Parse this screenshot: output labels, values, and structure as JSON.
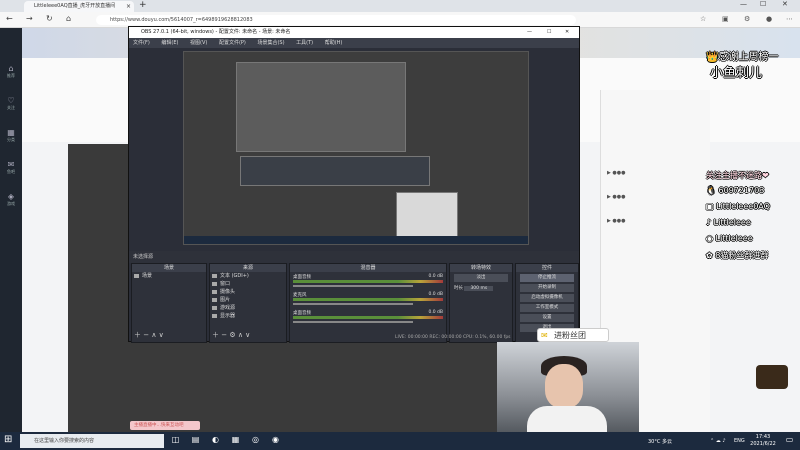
{
  "browser": {
    "tab_title": "Littleleee0AQ直播_虎牙开放直播间",
    "url": "https://www.douyu.com/5614007_r=6498919628812083"
  },
  "left_nav": [
    "推荐",
    "关注",
    "分类",
    "鱼吧",
    "游戏"
  ],
  "obs": {
    "window_title": "OBS 27.0.1 (64-bit, windows) - 配置文件: 未命名 - 场景: 未命名",
    "menu": [
      "文件(F)",
      "编辑(E)",
      "视图(V)",
      "配置文件(P)",
      "场景集合(S)",
      "工具(T)",
      "帮助(H)"
    ],
    "scene_label": "未选择源",
    "docks": {
      "scenes": "场景",
      "sources": "来源",
      "mixer": "混音器",
      "transitions": "转场特效",
      "controls": "控件"
    },
    "scenes_list": [
      "场景"
    ],
    "sources_list": [
      "文本 (GDI+)",
      "窗口",
      "摄像头",
      "图片",
      "游戏源",
      "显示器"
    ],
    "mixer": [
      {
        "name": "桌面音频",
        "value": "0.0 dB"
      },
      {
        "name": "麦克风",
        "value": "0.0 dB"
      },
      {
        "name": "桌面音频",
        "value": "0.0 dB"
      }
    ],
    "transition_type": "淡出",
    "transition_duration_label": "时长",
    "transition_duration": "300 ms",
    "control_buttons": [
      "停止推流",
      "开始录制",
      "启动虚拟摄像机",
      "工作室模式",
      "设置",
      "退出"
    ],
    "status": "LIVE: 00:00:00  REC: 00:00:00  CPU: 0.1%, 60.00 fps"
  },
  "overlay": {
    "thanks": "👑感谢上周榜一",
    "fan_name": "小鱼刺儿",
    "follow": "关注主播不迷路❤",
    "qq": "609721703",
    "bili": "Littleleee0AQ",
    "douyin": "Littleleee",
    "weibo": "Littleleee",
    "fans_group": "8猫粉丝群进群"
  },
  "fans_tag": "进粉丝团",
  "chat_hint": "主播直播中…快来互动吧",
  "taskbar": {
    "search_placeholder": "在这里输入你要搜索的内容",
    "weather": "30°C 多云",
    "lang": "ENG",
    "time": "17:43",
    "date": "2021/6/22"
  },
  "colors": {
    "obs_bg": "#2b2e38",
    "taskbar": "#1c2a3e",
    "overlay_text": "#ffffff"
  }
}
